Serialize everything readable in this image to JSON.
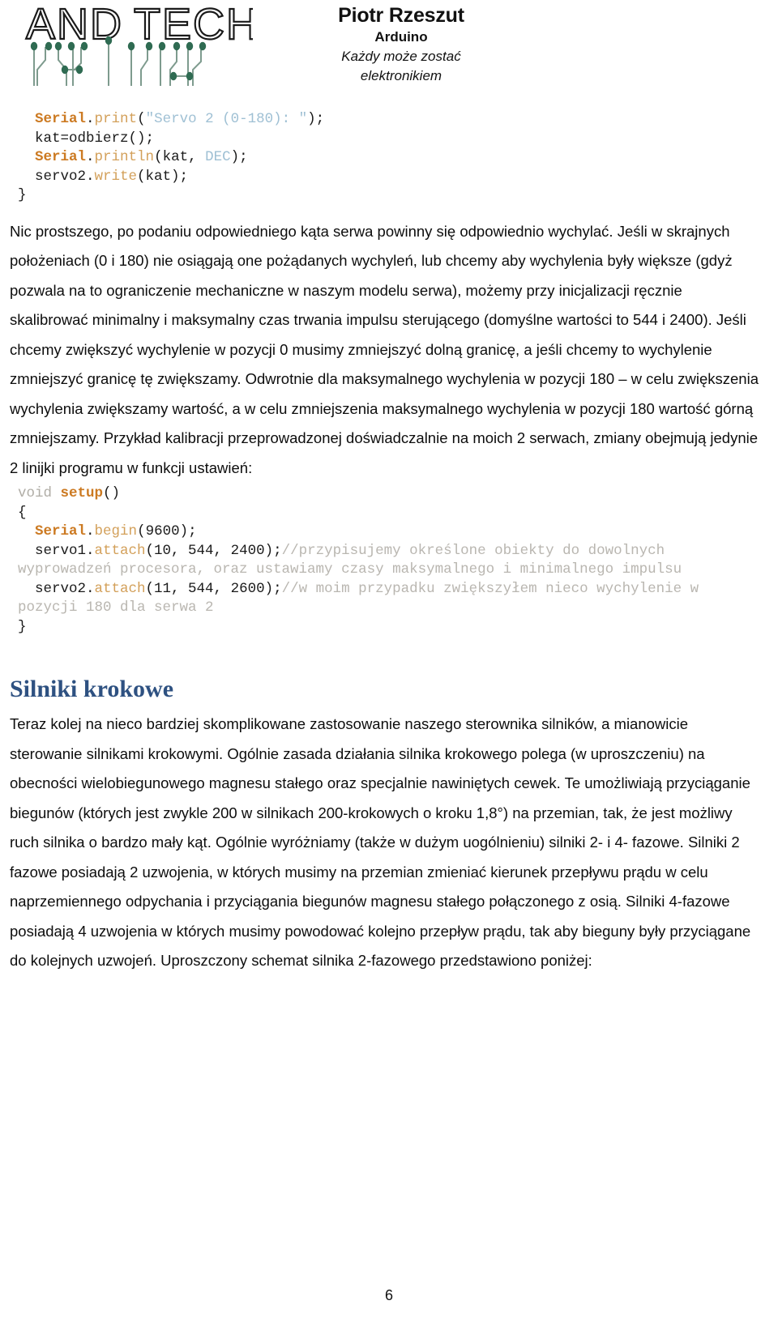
{
  "header": {
    "logo_alt": "AND TECH",
    "logo_word_1": "AND",
    "logo_word_2": "TECH",
    "author": "Piotr Rzeszut",
    "subject": "Arduino",
    "tagline_line1": "Każdy może zostać",
    "tagline_line2": "elektronikiem",
    "logo_trace_color": "#2f6b52",
    "logo_text_color": "#1a1a1a"
  },
  "code_block_1": {
    "lines": [
      [
        {
          "t": "  ",
          "c": "plain"
        },
        {
          "t": "Serial",
          "c": "cls"
        },
        {
          "t": ".",
          "c": "plain"
        },
        {
          "t": "print",
          "c": "fn"
        },
        {
          "t": "(",
          "c": "plain"
        },
        {
          "t": "\"Servo 2 (0-180): \"",
          "c": "str"
        },
        {
          "t": ");",
          "c": "plain"
        }
      ],
      [
        {
          "t": "  kat=odbierz();",
          "c": "plain"
        }
      ],
      [
        {
          "t": "  ",
          "c": "plain"
        },
        {
          "t": "Serial",
          "c": "cls"
        },
        {
          "t": ".",
          "c": "plain"
        },
        {
          "t": "println",
          "c": "fn"
        },
        {
          "t": "(kat, ",
          "c": "plain"
        },
        {
          "t": "DEC",
          "c": "const"
        },
        {
          "t": ");",
          "c": "plain"
        }
      ],
      [
        {
          "t": "  servo2.",
          "c": "plain"
        },
        {
          "t": "write",
          "c": "fn"
        },
        {
          "t": "(kat);",
          "c": "plain"
        }
      ],
      [
        {
          "t": "}",
          "c": "plain"
        }
      ]
    ]
  },
  "paragraph_1": "Nic prostszego, po podaniu odpowiedniego kąta serwa powinny się odpowiednio wychylać. Jeśli w skrajnych położeniach (0 i 180) nie osiągają one pożądanych wychyleń, lub chcemy aby wychylenia były większe (gdyż pozwala na to ograniczenie mechaniczne w naszym modelu serwa), możemy przy inicjalizacji ręcznie skalibrować minimalny i maksymalny czas trwania impulsu sterującego (domyślne wartości to 544 i 2400). Jeśli chcemy zwiększyć wychylenie w pozycji 0 musimy zmniejszyć dolną granicę, a jeśli chcemy to wychylenie zmniejszyć granicę tę zwiększamy. Odwrotnie dla maksymalnego wychylenia w pozycji 180 – w celu zwiększenia wychylenia zwiększamy wartość, a w celu zmniejszenia maksymalnego wychylenia w pozycji 180 wartość górną zmniejszamy. Przykład kalibracji przeprowadzonej doświadczalnie na moich 2 serwach, zmiany obejmują jedynie 2 linijki programu w funkcji ustawień:",
  "code_block_2": {
    "lines": [
      [
        {
          "t": "void ",
          "c": "kw"
        },
        {
          "t": "setup",
          "c": "kw2"
        },
        {
          "t": "()",
          "c": "plain"
        }
      ],
      [
        {
          "t": "{",
          "c": "plain"
        }
      ],
      [
        {
          "t": "  ",
          "c": "plain"
        },
        {
          "t": "Serial",
          "c": "cls"
        },
        {
          "t": ".",
          "c": "plain"
        },
        {
          "t": "begin",
          "c": "fn"
        },
        {
          "t": "(9600);",
          "c": "plain"
        }
      ],
      [
        {
          "t": "  servo1.",
          "c": "plain"
        },
        {
          "t": "attach",
          "c": "fn"
        },
        {
          "t": "(10, 544, 2400);",
          "c": "plain"
        },
        {
          "t": "//przypisujemy określone obiekty do dowolnych wyprowadzeń procesora, oraz ustawiamy czasy maksymalnego i minimalnego impulsu",
          "c": "cmt"
        }
      ],
      [
        {
          "t": "  servo2.",
          "c": "plain"
        },
        {
          "t": "attach",
          "c": "fn"
        },
        {
          "t": "(11, 544, 2600);",
          "c": "plain"
        },
        {
          "t": "//w moim przypadku zwiększyłem nieco wychylenie w pozycji 180 dla serwa 2",
          "c": "cmt"
        }
      ],
      [
        {
          "t": "}",
          "c": "plain"
        }
      ]
    ]
  },
  "section": {
    "heading": "Silniki krokowe",
    "heading_color": "#2e5181"
  },
  "paragraph_2": "Teraz kolej na nieco bardziej skomplikowane zastosowanie naszego sterownika silników, a mianowicie sterowanie silnikami krokowymi. Ogólnie zasada działania silnika krokowego polega (w uproszczeniu) na obecności wielobiegunowego magnesu stałego oraz specjalnie nawiniętych cewek. Te umożliwiają przyciąganie biegunów (których jest zwykle 200 w silnikach 200-krokowych o kroku 1,8°) na przemian, tak, że jest możliwy ruch silnika o bardzo mały kąt. Ogólnie wyróżniamy (także w dużym uogólnieniu) silniki 2- i 4- fazowe. Silniki 2 fazowe posiadają 2 uzwojenia, w których musimy na przemian zmieniać kierunek przepływu prądu w celu naprzemiennego odpychania i przyciągania biegunów magnesu stałego połączonego z osią. Silniki 4-fazowe posiadają 4 uzwojenia w których musimy powodować kolejno przepływ prądu, tak aby bieguny były przyciągane do kolejnych uzwojeń. Uproszczony schemat silnika 2-fazowego przedstawiono poniżej:",
  "footer": {
    "page_number": "6"
  }
}
